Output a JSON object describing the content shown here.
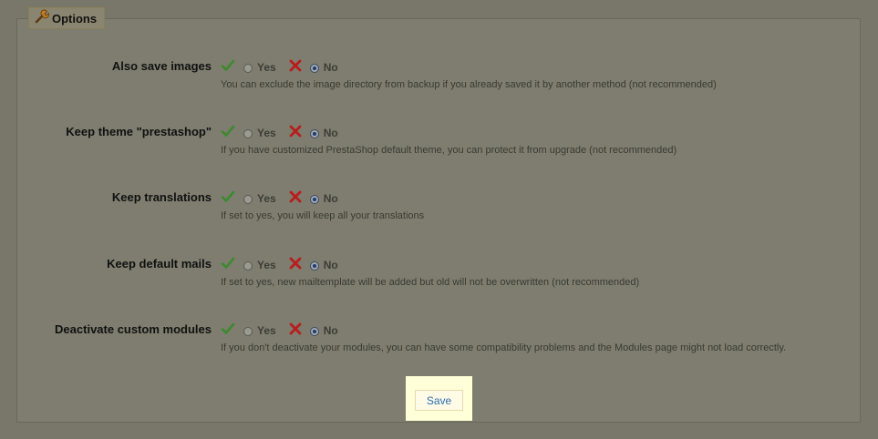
{
  "options": {
    "legend_title": "Options",
    "legend_icon": "wrench-icon",
    "yes_label": "Yes",
    "no_label": "No",
    "rows": [
      {
        "label": "Also save images",
        "selected": "No",
        "hint": "You can exclude the image directory from backup if you already saved it by another method (not recommended)"
      },
      {
        "label": "Keep theme \"prestashop\"",
        "selected": "No",
        "hint": "If you have customized PrestaShop default theme, you can protect it from upgrade (not recommended)"
      },
      {
        "label": "Keep translations",
        "selected": "No",
        "hint": "If set to yes, you will keep all your translations"
      },
      {
        "label": "Keep default mails",
        "selected": "No",
        "hint": "If set to yes, new mailtemplate will be added but old will not be overwritten (not recommended)"
      },
      {
        "label": "Deactivate custom modules",
        "selected": "No",
        "hint": "If you don't deactivate your modules, you can have some compatibility problems and the Modules page might not load correctly."
      }
    ],
    "save_label": "Save"
  },
  "colors": {
    "overlay_background": "#78776a",
    "save_highlight": "#ffffd8",
    "save_text": "#2a6db5",
    "check_green": "#3c8a2e",
    "cross_red": "#b81d1d"
  }
}
